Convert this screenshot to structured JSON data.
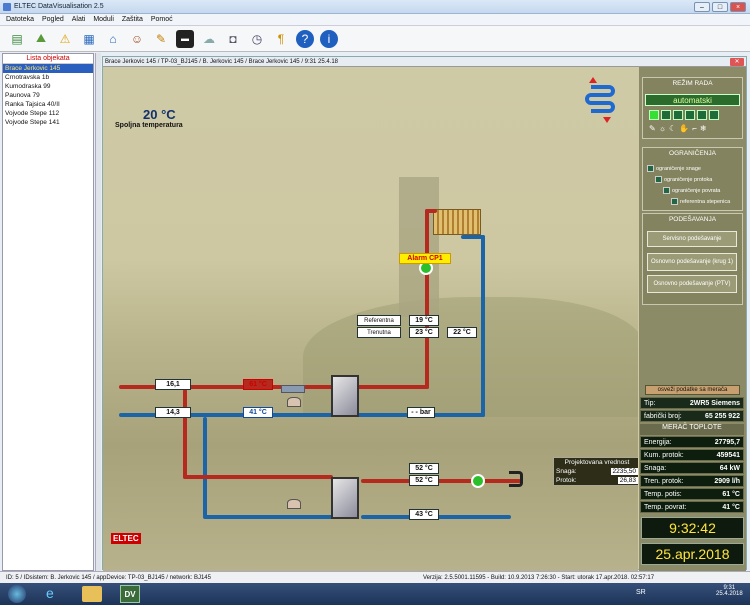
{
  "window": {
    "title": "ELTEC DataVisualisation 2.5"
  },
  "menu": [
    "Datoteka",
    "Pogled",
    "Alati",
    "Moduli",
    "Zaštita",
    "Pomoć"
  ],
  "toolbar_icons": [
    "chart-icon",
    "map-icon",
    "warning-icon",
    "book-icon",
    "house-icon",
    "users-icon",
    "pen-icon",
    "meter-icon",
    "cloud-icon",
    "database-icon",
    "clock-icon",
    "key-icon",
    "help-icon",
    "info-icon"
  ],
  "sidebar": {
    "header": "Lista objekata",
    "items": [
      "Brace Jerkovic 145",
      "Crnotravska 1b",
      "Kumodraska 99",
      "Paunova 79",
      "Ranka Tajsica 40/II",
      "Vojvode Stepe 112",
      "Vojvode Stepe 141"
    ],
    "selected_index": 0
  },
  "child": {
    "title": "Brace Jerkovic 145 / TP-03_BJ145 / B. Jerkovic 145 / Brace Jerkovic 145 / 9:31 25.4.18"
  },
  "scene": {
    "outside_temp": "20 °C",
    "outside_label": "Spoljna temperatura",
    "alarm_label": "Alarm CP1",
    "ref_label": "Referentna",
    "cur_label": "Trenutna",
    "ref_temp": "19 °C",
    "cur_temp": "23 °C",
    "return_temp": "22 °C",
    "primary_supply": "16,1",
    "primary_return": "14,3",
    "sec_supply": "61 °C",
    "sec_return": "41 °C",
    "pressure": "- - bar",
    "dhw_temp1": "52 °C",
    "dhw_temp2": "52 °C",
    "dhw_return": "43 °C",
    "logo": "ELTEC"
  },
  "projected": {
    "title": "Projektovana vrednost",
    "rows": [
      {
        "label": "Snaga:",
        "value": "2235,50"
      },
      {
        "label": "Protok:",
        "value": "26,83"
      }
    ]
  },
  "right": {
    "mode_title": "REŽIM RADA",
    "mode_value": "automatski",
    "limits_title": "OGRANIČENJA",
    "limits": [
      "ograničenje snage",
      "ograničenje protoka",
      "ograničenje povrata",
      "referentna stepenica"
    ],
    "settings_title": "PODEŠAVANJA",
    "buttons": [
      "Servisno podešavanje",
      "Osnovno podešavanje (krug 1)",
      "Osnovno podešavanje (PTV)"
    ],
    "refresh_label": "osveži podatke sa merača",
    "meter_type_label": "Tip:",
    "meter_type": "2WR5 Siemens",
    "meter_no_label": "fabrički broj:",
    "meter_no": "65 255 922",
    "heat_meter_title": "MERAČ TOPLOTE",
    "readings": [
      {
        "label": "Energija:",
        "value": "27795,7"
      },
      {
        "label": "Kum. protok:",
        "value": "459541"
      },
      {
        "label": "Snaga:",
        "value": "64 kW"
      },
      {
        "label": "Tren. protok:",
        "value": "2909 l/h"
      },
      {
        "label": "Temp. potis:",
        "value": "61 °C"
      },
      {
        "label": "Temp. povrat:",
        "value": "41 °C"
      }
    ],
    "time": "9:32:42",
    "date": "25.apr.2018"
  },
  "status": "ID: 5 / IDsistem: B. Jerkovic 145 / appDevice: TP-03_BJ145 / network: BJ145",
  "version": "Verzija: 2.5.5001.11595 - Build: 10.9.2013 7:26:30 - Start: utorak 17.apr.2018. 02:57:17",
  "taskbar": {
    "lang": "SR",
    "time": "9:31",
    "date": "25.4.2018",
    "app": "DV"
  }
}
